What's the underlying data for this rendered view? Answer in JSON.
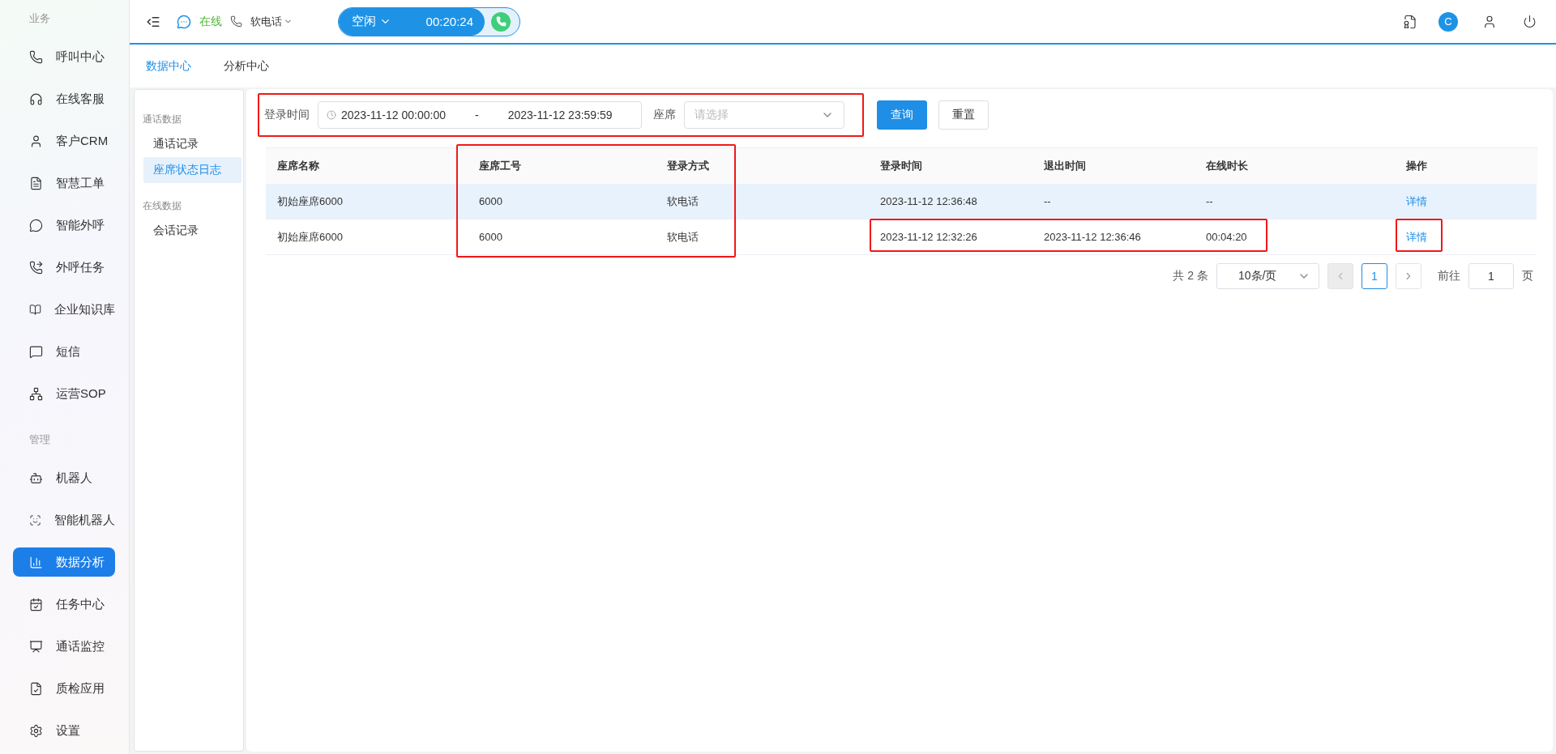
{
  "sidebar": {
    "sections": [
      {
        "label": "业务",
        "items": [
          {
            "label": "呼叫中心",
            "selected": false
          },
          {
            "label": "在线客服",
            "selected": false
          },
          {
            "label": "客户CRM",
            "selected": false
          },
          {
            "label": "智慧工单",
            "selected": false
          },
          {
            "label": "智能外呼",
            "selected": false
          },
          {
            "label": "外呼任务",
            "selected": false
          },
          {
            "label": "企业知识库",
            "selected": false
          },
          {
            "label": "短信",
            "selected": false
          },
          {
            "label": "运营SOP",
            "selected": false
          }
        ]
      },
      {
        "label": "管理",
        "items": [
          {
            "label": "机器人",
            "selected": false
          },
          {
            "label": "智能机器人",
            "selected": false
          },
          {
            "label": "数据分析",
            "selected": true
          },
          {
            "label": "任务中心",
            "selected": false
          },
          {
            "label": "通话监控",
            "selected": false
          },
          {
            "label": "质检应用",
            "selected": false
          },
          {
            "label": "设置",
            "selected": false
          }
        ]
      }
    ]
  },
  "topbar": {
    "status": "在线",
    "phone_mode": "软电话",
    "agent_state": "空闲",
    "timer": "00:20:24",
    "avatar": "C"
  },
  "tabs": [
    {
      "label": "数据中心",
      "selected": true
    },
    {
      "label": "分析中心",
      "selected": false
    }
  ],
  "subnav": [
    {
      "label": "通话数据",
      "items": [
        {
          "label": "通话记录",
          "selected": false
        },
        {
          "label": "座席状态日志",
          "selected": true
        }
      ]
    },
    {
      "label": "在线数据",
      "items": [
        {
          "label": "会话记录",
          "selected": false
        }
      ]
    }
  ],
  "filter": {
    "time_label": "登录时间",
    "start": "2023-11-12 00:00:00",
    "separator": "-",
    "end": "2023-11-12 23:59:59",
    "seat_label": "座席",
    "seat_placeholder": "请选择",
    "buttons": [
      {
        "label": "查询",
        "kind": "primary"
      },
      {
        "label": "重置",
        "kind": "default"
      }
    ]
  },
  "table": {
    "columns": [
      "座席名称",
      "座席工号",
      "登录方式",
      "登录时间",
      "退出时间",
      "在线时长",
      "操作"
    ],
    "rows": [
      {
        "highlighted": true,
        "cells": [
          "初始座席6000",
          "6000",
          "软电话",
          "2023-11-12 12:36:48",
          "--",
          "--"
        ],
        "action": "详情"
      },
      {
        "highlighted": false,
        "cells": [
          "初始座席6000",
          "6000",
          "软电话",
          "2023-11-12 12:32:26",
          "2023-11-12 12:36:46",
          "00:04:20"
        ],
        "action": "详情"
      }
    ]
  },
  "pagination": {
    "total": "共 2 条",
    "page_size": "10条/页",
    "prev_disabled": true,
    "next_disabled": false,
    "pages": [
      {
        "label": "1",
        "selected": true
      }
    ],
    "goto_label": "前往",
    "goto_value": "1",
    "goto_suffix": "页"
  }
}
